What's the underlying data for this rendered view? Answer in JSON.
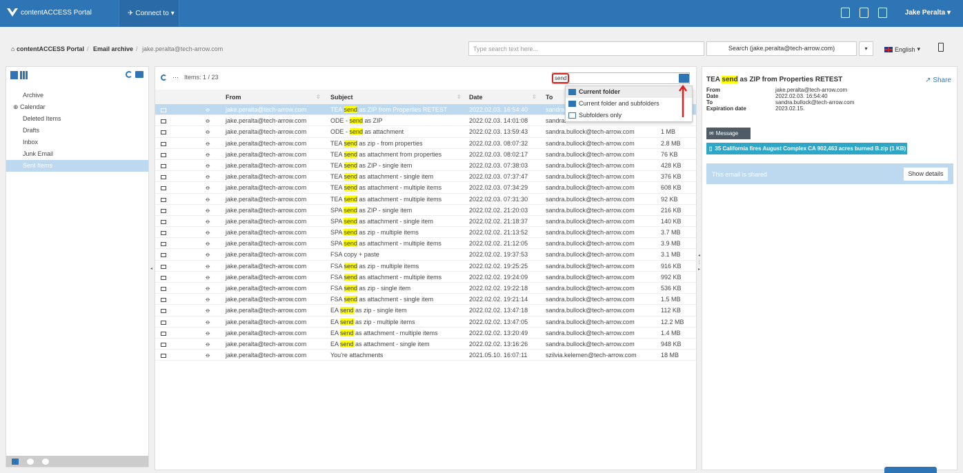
{
  "app": {
    "title": "contentACCESS Portal",
    "connect_label": "Connect to",
    "user": "Jake Peralta"
  },
  "breadcrumb": {
    "home": "contentACCESS Portal",
    "archive": "Email archive",
    "current": "jake.peralta@tech-arrow.com"
  },
  "search": {
    "placeholder": "Type search text here...",
    "button": "Search (jake.peralta@tech-arrow.com)",
    "language": "English"
  },
  "folders": [
    {
      "label": "Archive"
    },
    {
      "label": "Calendar"
    },
    {
      "label": "Deleted Items"
    },
    {
      "label": "Drafts"
    },
    {
      "label": "Inbox"
    },
    {
      "label": "Junk Email"
    },
    {
      "label": "Sent Items"
    }
  ],
  "list": {
    "items_label": "Items: 1 / 23",
    "filter_value": "send",
    "headers": {
      "from": "From",
      "subject": "Subject",
      "date": "Date",
      "to": "To"
    },
    "rows": [
      {
        "from": "jake.peralta@tech-arrow.com",
        "pre": "TEA ",
        "hl": "send",
        "post": " as ZIP from Properties RETEST",
        "date": "2022.02.03. 16:54:40",
        "to": "sandra.",
        "size": ""
      },
      {
        "from": "jake.peralta@tech-arrow.com",
        "pre": "ODE - ",
        "hl": "send",
        "post": " as ZIP",
        "date": "2022.02.03. 14:01:08",
        "to": "sandra.",
        "size": ""
      },
      {
        "from": "jake.peralta@tech-arrow.com",
        "pre": "ODE - ",
        "hl": "send",
        "post": " as attachment",
        "date": "2022.02.03. 13:59:43",
        "to": "sandra.bullock@tech-arrow.com",
        "size": "1 MB"
      },
      {
        "from": "jake.peralta@tech-arrow.com",
        "pre": "TEA ",
        "hl": "send",
        "post": " as zip - from properties",
        "date": "2022.02.03. 08:07:32",
        "to": "sandra.bullock@tech-arrow.com",
        "size": "2.8 MB"
      },
      {
        "from": "jake.peralta@tech-arrow.com",
        "pre": "TEA ",
        "hl": "send",
        "post": " as attachment from properties",
        "date": "2022.02.03. 08:02:17",
        "to": "sandra.bullock@tech-arrow.com",
        "size": "76 KB"
      },
      {
        "from": "jake.peralta@tech-arrow.com",
        "pre": "TEA ",
        "hl": "send",
        "post": " as ZIP - single item",
        "date": "2022.02.03. 07:38:03",
        "to": "sandra.bullock@tech-arrow.com",
        "size": "428 KB"
      },
      {
        "from": "jake.peralta@tech-arrow.com",
        "pre": "TEA ",
        "hl": "send",
        "post": " as attachment - single item",
        "date": "2022.02.03. 07:37:47",
        "to": "sandra.bullock@tech-arrow.com",
        "size": "376 KB"
      },
      {
        "from": "jake.peralta@tech-arrow.com",
        "pre": "TEA ",
        "hl": "send",
        "post": " as attachment - multiple items",
        "date": "2022.02.03. 07:34:29",
        "to": "sandra.bullock@tech-arrow.com",
        "size": "608 KB"
      },
      {
        "from": "jake.peralta@tech-arrow.com",
        "pre": "TEA ",
        "hl": "send",
        "post": " as attachment - multiple items",
        "date": "2022.02.03. 07:31:30",
        "to": "sandra.bullock@tech-arrow.com",
        "size": "92 KB"
      },
      {
        "from": "jake.peralta@tech-arrow.com",
        "pre": "SPA ",
        "hl": "send",
        "post": " as ZIP - single item",
        "date": "2022.02.02. 21:20:03",
        "to": "sandra.bullock@tech-arrow.com",
        "size": "216 KB"
      },
      {
        "from": "jake.peralta@tech-arrow.com",
        "pre": "SPA ",
        "hl": "send",
        "post": " as attachment - single item",
        "date": "2022.02.02. 21:18:37",
        "to": "sandra.bullock@tech-arrow.com",
        "size": "140 KB"
      },
      {
        "from": "jake.peralta@tech-arrow.com",
        "pre": "SPA ",
        "hl": "send",
        "post": " as zip - multiple items",
        "date": "2022.02.02. 21:13:52",
        "to": "sandra.bullock@tech-arrow.com",
        "size": "3.7 MB"
      },
      {
        "from": "jake.peralta@tech-arrow.com",
        "pre": "SPA ",
        "hl": "send",
        "post": " as attachment - multiple items",
        "date": "2022.02.02. 21:12:05",
        "to": "sandra.bullock@tech-arrow.com",
        "size": "3.9 MB"
      },
      {
        "from": "jake.peralta@tech-arrow.com",
        "pre": "FSA copy + paste",
        "hl": "",
        "post": "",
        "date": "2022.02.02. 19:37:53",
        "to": "sandra.bullock@tech-arrow.com",
        "size": "3.1 MB"
      },
      {
        "from": "jake.peralta@tech-arrow.com",
        "pre": "FSA ",
        "hl": "send",
        "post": " as zip - multiple items",
        "date": "2022.02.02. 19:25:25",
        "to": "sandra.bullock@tech-arrow.com",
        "size": "916 KB"
      },
      {
        "from": "jake.peralta@tech-arrow.com",
        "pre": "FSA ",
        "hl": "send",
        "post": " as attachment - multiple items",
        "date": "2022.02.02. 19:24:09",
        "to": "sandra.bullock@tech-arrow.com",
        "size": "992 KB"
      },
      {
        "from": "jake.peralta@tech-arrow.com",
        "pre": "FSA ",
        "hl": "send",
        "post": " as zip - single item",
        "date": "2022.02.02. 19:22:18",
        "to": "sandra.bullock@tech-arrow.com",
        "size": "536 KB"
      },
      {
        "from": "jake.peralta@tech-arrow.com",
        "pre": "FSA ",
        "hl": "send",
        "post": " as attachment - single item",
        "date": "2022.02.02. 19:21:14",
        "to": "sandra.bullock@tech-arrow.com",
        "size": "1.5 MB"
      },
      {
        "from": "jake.peralta@tech-arrow.com",
        "pre": "EA ",
        "hl": "send",
        "post": " as zip - single item",
        "date": "2022.02.02. 13:47:18",
        "to": "sandra.bullock@tech-arrow.com",
        "size": "112 KB"
      },
      {
        "from": "jake.peralta@tech-arrow.com",
        "pre": "EA ",
        "hl": "send",
        "post": " as zip - multiple items",
        "date": "2022.02.02. 13:47:05",
        "to": "sandra.bullock@tech-arrow.com",
        "size": "12.2 MB"
      },
      {
        "from": "jake.peralta@tech-arrow.com",
        "pre": "EA ",
        "hl": "send",
        "post": " as attachment - multiple items",
        "date": "2022.02.02. 13:20:49",
        "to": "sandra.bullock@tech-arrow.com",
        "size": "1.4 MB"
      },
      {
        "from": "jake.peralta@tech-arrow.com",
        "pre": "EA ",
        "hl": "send",
        "post": " as attachment - single item",
        "date": "2022.02.02. 13:16:26",
        "to": "sandra.bullock@tech-arrow.com",
        "size": "948 KB"
      },
      {
        "from": "jake.peralta@tech-arrow.com",
        "pre": "You're attachments",
        "hl": "",
        "post": "",
        "date": "2021.05.10. 16:07:11",
        "to": "szilvia.kelemen@tech-arrow.com",
        "size": "18 MB"
      }
    ]
  },
  "scope_menu": {
    "items": [
      "Current folder",
      "Current folder and subfolders",
      "Subfolders only"
    ]
  },
  "preview": {
    "title_pre": "TEA ",
    "title_hl": "send",
    "title_post": " as ZIP from Properties RETEST",
    "share": "Share",
    "from_k": "From",
    "from_v": "jake.peralta@tech-arrow.com",
    "date_k": "Date",
    "date_v": "2022.02.03. 16:54:40",
    "to_k": "To",
    "to_v": "sandra.bullock@tech-arrow.com",
    "exp_k": "Expiration date",
    "exp_v": "2023.02.15.",
    "message_btn": "Message",
    "attachment": "35 California fires August Complex CA 902,463 acres burned B.zip (1 KB)",
    "shared_text": "This email is shared",
    "show_details": "Show details"
  },
  "colors": {
    "brand": "#2e75b6",
    "selection": "#bcd9f0",
    "highlight": "#ffff00",
    "annotation": "#dd2222"
  }
}
